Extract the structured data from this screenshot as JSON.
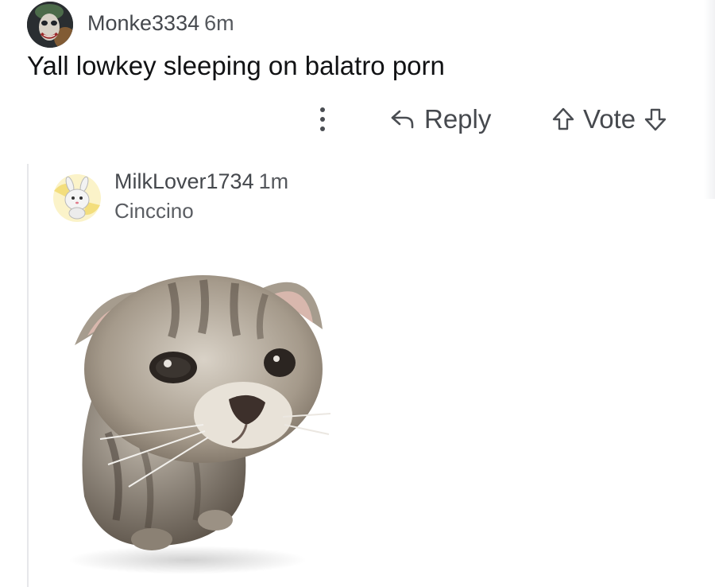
{
  "comment": {
    "author": "Monke3334",
    "time": "6m",
    "body": "Yall lowkey sleeping on balatro porn",
    "avatar_icon": "joker-avatar-icon",
    "actions": {
      "more_icon": "more-vertical-icon",
      "reply_icon": "reply-arrow-icon",
      "reply_label": "Reply",
      "upvote_icon": "upvote-arrow-icon",
      "vote_label": "Vote",
      "downvote_icon": "downvote-arrow-icon"
    }
  },
  "reply": {
    "author": "MilkLover1734",
    "time": "1m",
    "flair": "Cinccino",
    "avatar_icon": "cinccino-avatar-icon",
    "image_icon": "kitten-photo"
  },
  "colors": {
    "text_primary": "#111214",
    "text_secondary": "#45484d",
    "thread_line": "#e6e7ea",
    "background": "#ffffff"
  }
}
